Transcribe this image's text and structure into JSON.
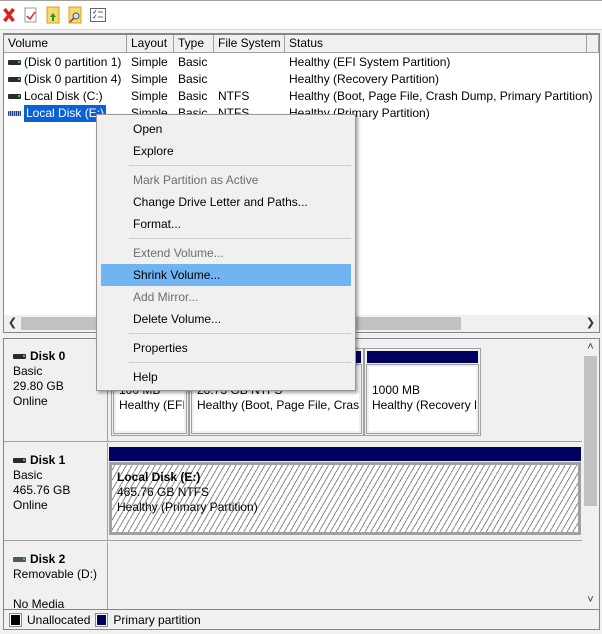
{
  "toolbar": {
    "buttons": [
      {
        "name": "delete",
        "icon": "red-x-icon"
      },
      {
        "name": "properties",
        "icon": "check-document-icon"
      },
      {
        "name": "open",
        "icon": "folder-up-icon"
      },
      {
        "name": "explore",
        "icon": "folder-search-icon"
      },
      {
        "name": "settings",
        "icon": "checklist-icon"
      }
    ]
  },
  "volume_list": {
    "columns": [
      "Volume",
      "Layout",
      "Type",
      "File System",
      "Status"
    ],
    "rows": [
      {
        "volume": "(Disk 0 partition 1)",
        "layout": "Simple",
        "type": "Basic",
        "fs": "",
        "status": "Healthy (EFI System Partition)",
        "selected": false
      },
      {
        "volume": "(Disk 0 partition 4)",
        "layout": "Simple",
        "type": "Basic",
        "fs": "",
        "status": "Healthy (Recovery Partition)",
        "selected": false
      },
      {
        "volume": "Local Disk (C:)",
        "layout": "Simple",
        "type": "Basic",
        "fs": "NTFS",
        "status": "Healthy (Boot, Page File, Crash Dump, Primary Partition)",
        "selected": false
      },
      {
        "volume": "Local Disk (E:)",
        "layout": "Simple",
        "type": "Basic",
        "fs": "NTFS",
        "status": "Healthy (Primary Partition)",
        "selected": true
      }
    ]
  },
  "context_menu": {
    "items": [
      {
        "label": "Open",
        "enabled": true
      },
      {
        "label": "Explore",
        "enabled": true
      },
      {
        "separator": true
      },
      {
        "label": "Mark Partition as Active",
        "enabled": false
      },
      {
        "label": "Change Drive Letter and Paths...",
        "enabled": true
      },
      {
        "label": "Format...",
        "enabled": true
      },
      {
        "separator": true
      },
      {
        "label": "Extend Volume...",
        "enabled": false
      },
      {
        "label": "Shrink Volume...",
        "enabled": true,
        "highlighted": true
      },
      {
        "label": "Add Mirror...",
        "enabled": false
      },
      {
        "label": "Delete Volume...",
        "enabled": true
      },
      {
        "separator": true
      },
      {
        "label": "Properties",
        "enabled": true
      },
      {
        "separator": true
      },
      {
        "label": "Help",
        "enabled": true
      }
    ]
  },
  "disks": [
    {
      "name": "Disk 0",
      "type": "Basic",
      "size": "29.80 GB",
      "state": "Online",
      "partitions": [
        {
          "title": "",
          "size": "100 MB",
          "status": "Healthy (EFI"
        },
        {
          "title": "",
          "size": "28.73 GB NTFS",
          "status": "Healthy (Boot, Page File, Crash"
        },
        {
          "title": "",
          "size": "1000 MB",
          "status": "Healthy (Recovery F"
        }
      ]
    },
    {
      "name": "Disk 1",
      "type": "Basic",
      "size": "465.76 GB",
      "state": "Online",
      "partitions": [
        {
          "title": "Local Disk  (E:)",
          "size": "465.76 GB NTFS",
          "status": "Healthy (Primary Partition)",
          "selected": true
        }
      ]
    },
    {
      "name": "Disk 2",
      "type": "Removable (D:)",
      "size": "",
      "state": "No Media",
      "partitions": []
    }
  ],
  "legend": [
    {
      "label": "Unallocated",
      "color": "#000000"
    },
    {
      "label": "Primary partition",
      "color": "#000060"
    }
  ],
  "colors": {
    "selection": "#0b62d6",
    "menu_highlight": "#71b4f2",
    "partition_header": "#000060"
  }
}
